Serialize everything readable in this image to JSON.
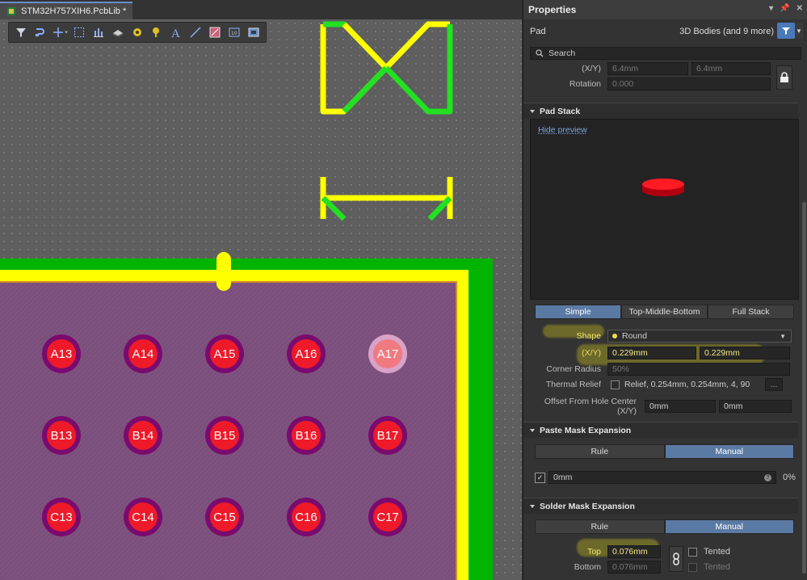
{
  "document": {
    "tab_title": "STM32H757XIH6.PcbLib *"
  },
  "toolbar": {
    "icons": [
      "filter-icon",
      "route-icon",
      "place-cross-icon",
      "select-rect-icon",
      "align-icon",
      "layer-icon",
      "pad-icon",
      "via-icon",
      "string-icon",
      "line-icon",
      "fill-icon",
      "dimension-icon",
      "region-icon"
    ]
  },
  "pads": {
    "row_a": [
      "A13",
      "A14",
      "A15",
      "A16",
      "A17"
    ],
    "row_b": [
      "B13",
      "B14",
      "B15",
      "B16",
      "B17"
    ],
    "row_c": [
      "C13",
      "C14",
      "C15",
      "C16",
      "C17"
    ]
  },
  "colors": {
    "pad_outer": "#7a0b6e",
    "pad_core": "#ee1a2a",
    "silk_yellow": "#ffff00",
    "courtyard_green": "#00c800",
    "accent": "#4a79b8"
  },
  "panel": {
    "title": "Properties",
    "object_type": "Pad",
    "filter_label": "3D Bodies (and 9 more)",
    "search_placeholder": "Search",
    "xy_label": "(X/Y)",
    "x_value": "6.4mm",
    "y_value": "6.4mm",
    "rotation_label": "Rotation",
    "rotation_value": "0.000"
  },
  "pad_stack": {
    "header": "Pad Stack",
    "hide_preview": "Hide preview",
    "tabs": [
      "Simple",
      "Top-Middle-Bottom",
      "Full Stack"
    ],
    "shape_label": "Shape",
    "shape_value": "Round",
    "size_label": "(X/Y)",
    "size_x": "0.229mm",
    "size_y": "0.229mm",
    "corner_radius_label": "Corner Radius",
    "corner_radius_value": "50%",
    "thermal_relief_label": "Thermal Relief",
    "thermal_relief_value": "Relief, 0.254mm, 0.254mm, 4, 90",
    "thermal_relief_button": "...",
    "offset_label": "Offset From Hole Center (X/Y)",
    "offset_x": "0mm",
    "offset_y": "0mm"
  },
  "paste_mask": {
    "header": "Paste Mask Expansion",
    "tabs": [
      "Rule",
      "Manual"
    ],
    "value": "0mm",
    "percent": "0%"
  },
  "solder_mask": {
    "header": "Solder Mask Expansion",
    "tabs": [
      "Rule",
      "Manual"
    ],
    "top_label": "Top",
    "top_value": "0.076mm",
    "bottom_label": "Bottom",
    "bottom_value": "0.076mm",
    "tented_label": "Tented"
  }
}
